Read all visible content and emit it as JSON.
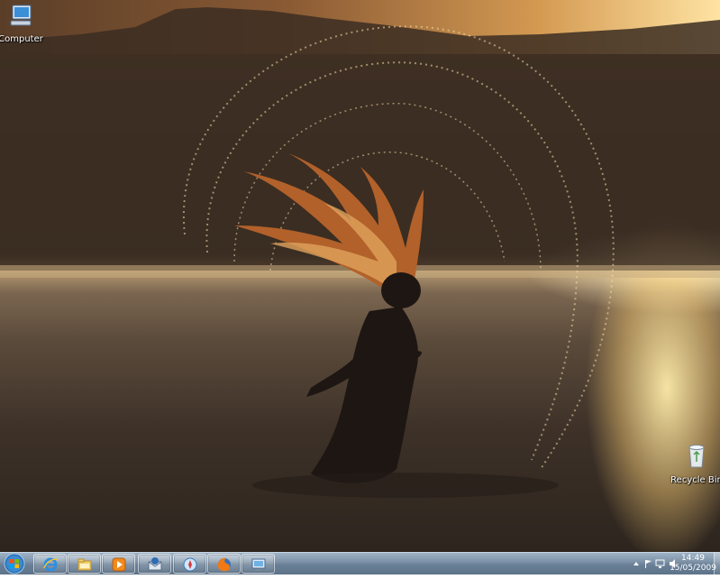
{
  "desktop": {
    "icons": [
      {
        "label": "Computer",
        "icon": "computer-icon"
      },
      {
        "label": "Recycle Bin",
        "icon": "recycle-bin-icon"
      }
    ]
  },
  "taskbar": {
    "start": {
      "icon": "windows-start-orb-icon"
    },
    "pinned": [
      {
        "icon": "internet-explorer-icon"
      },
      {
        "icon": "file-explorer-icon"
      },
      {
        "icon": "media-player-icon"
      },
      {
        "icon": "thunderbird-icon"
      },
      {
        "icon": "safari-icon"
      },
      {
        "icon": "firefox-icon"
      },
      {
        "icon": "remote-desktop-icon"
      }
    ],
    "tray": {
      "icons": [
        "show-hidden-icons-chevron",
        "flag-icon",
        "network-icon",
        "volume-icon"
      ],
      "time": "14:49",
      "date": "15/05/2009"
    }
  }
}
